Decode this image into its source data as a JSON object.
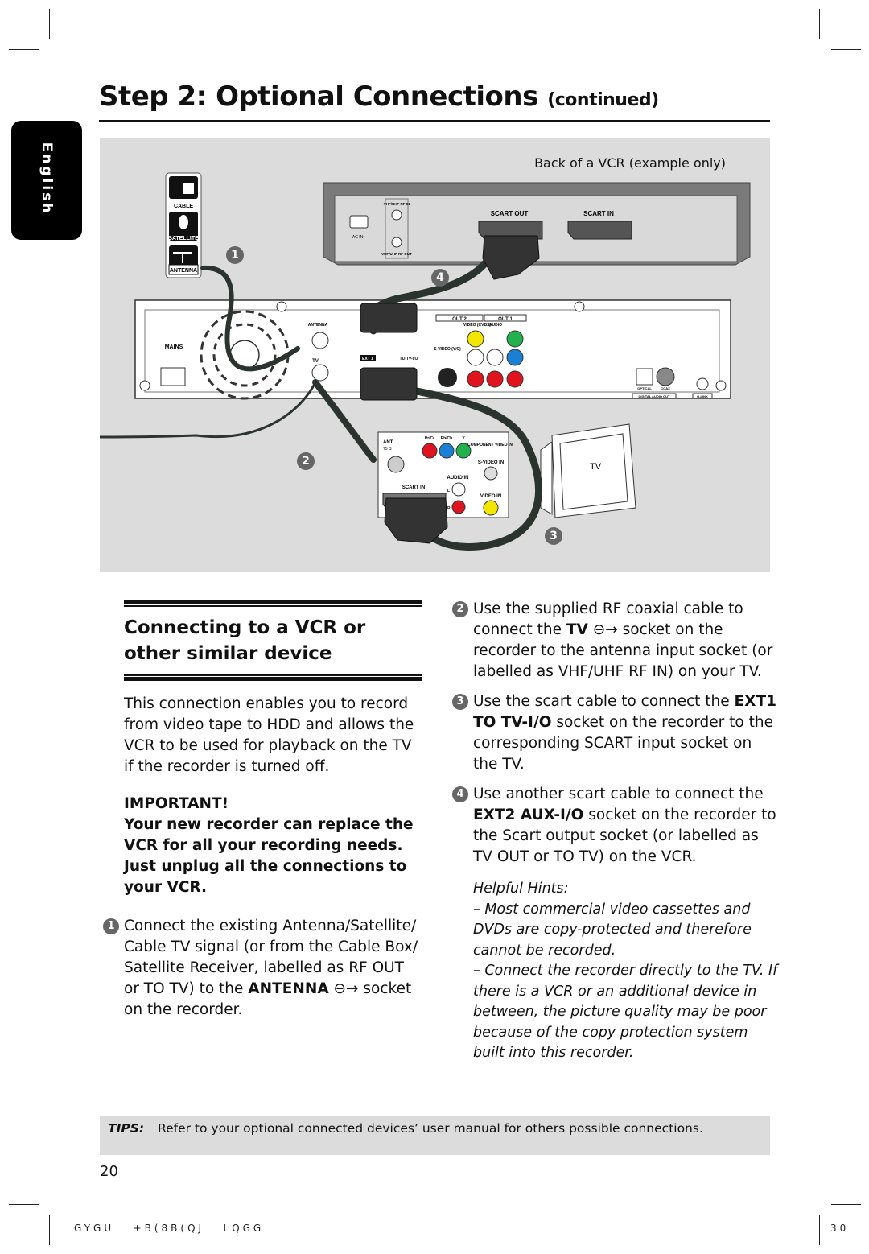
{
  "header": {
    "title": "Step 2: Optional Connections",
    "title_suffix": "(continued)",
    "language_tab": "English"
  },
  "figure": {
    "caption": "Back of a VCR (example only)",
    "source_icons": [
      {
        "name": "cable-icon",
        "label": "CABLE"
      },
      {
        "name": "satellite-icon",
        "label": "SATELLITE"
      },
      {
        "name": "antenna-icon",
        "label": "ANTENNA"
      }
    ],
    "vcr_labels": {
      "ac_in": "AC IN~",
      "rf_in": "VHF/UHF RF IN",
      "rf_out": "VHF/UHF RF OUT",
      "scart_out": "SCART OUT",
      "scart_in": "SCART IN"
    },
    "recorder_labels": {
      "mains": "MAINS",
      "antenna": "ANTENNA",
      "tv": "TV",
      "ext1": "EXT 1",
      "to_tv_io": "TO TV-I/O",
      "out2": "OUT 2",
      "out1": "OUT 1",
      "video_cvbs": "VIDEO (CVBS)",
      "audio": "AUDIO",
      "s_video": "S-VIDEO (Y/C)",
      "optical": "OPTICAL",
      "coax": "COAX",
      "digital_audio_out": "DIGITAL AUDIO OUT",
      "g_link": "G-LINK"
    },
    "tv_panel_labels": {
      "ant": "ANT",
      "ant_imp": "75 Ω",
      "pr": "Pr/Cr",
      "pb": "Pb/Cb",
      "y": "Y",
      "component": "COMPONENT VIDEO IN",
      "s_video_in": "S-VIDEO IN",
      "audio_in": "AUDIO IN",
      "l": "L",
      "r": "R",
      "video_in": "VIDEO IN",
      "scart_in": "SCART IN"
    },
    "tv_label": "TV",
    "callouts": [
      "1",
      "2",
      "3",
      "4"
    ],
    "colors": {
      "background": "#dcdcdc",
      "cable": "#2b332f",
      "yellow": "#f2e600",
      "red": "#e0141e",
      "green": "#22b14c",
      "blue": "#1c7fd6",
      "callout": "#666666"
    }
  },
  "section": {
    "heading_line1": "Connecting to a VCR or",
    "heading_line2": "other similar device",
    "intro": "This connection enables you to record from video tape to HDD and allows the VCR to be used for playback on the TV if the recorder is turned off.",
    "important_label": "IMPORTANT!",
    "important_text": "Your new recorder can replace the VCR for all your recording needs. Just unplug all the connections to your VCR.",
    "steps": [
      {
        "num": "1",
        "pre": "Connect the existing Antenna/Satellite/ Cable TV signal (or from the Cable Box/ Satellite Receiver, labelled as RF OUT or TO TV) to the ",
        "bold": "ANTENNA",
        "post": " socket on the recorder."
      },
      {
        "num": "2",
        "pre": "Use the supplied RF coaxial cable to connect the ",
        "bold": "TV",
        "post": " socket on the recorder to the antenna input socket (or labelled as VHF/UHF RF IN) on your TV."
      },
      {
        "num": "3",
        "pre": "Use the scart cable to connect the ",
        "bold": "EXT1 TO TV-I/O",
        "post": " socket on the recorder to the corresponding SCART input socket on the TV."
      },
      {
        "num": "4",
        "pre": "Use another scart cable to connect the ",
        "bold": "EXT2 AUX-I/O",
        "post": " socket on the recorder to the Scart output socket (or labelled as TV OUT or TO TV) on the VCR."
      }
    ],
    "hints_title": "Helpful Hints:",
    "hints": [
      "– Most commercial video cassettes and DVDs are copy-protected and therefore cannot be recorded.",
      "– Connect the recorder directly to the TV. If there is a VCR or an additional device in between, the picture quality may be poor because of the copy protection system built into this recorder."
    ]
  },
  "tips": {
    "label": "TIPS:",
    "text": "Refer to your optional connected devices’ user manual for others possible connections."
  },
  "page_number": "20",
  "footer": {
    "code": "GYGU   +B(8B(QJ   LQGG",
    "sheet": "30"
  }
}
